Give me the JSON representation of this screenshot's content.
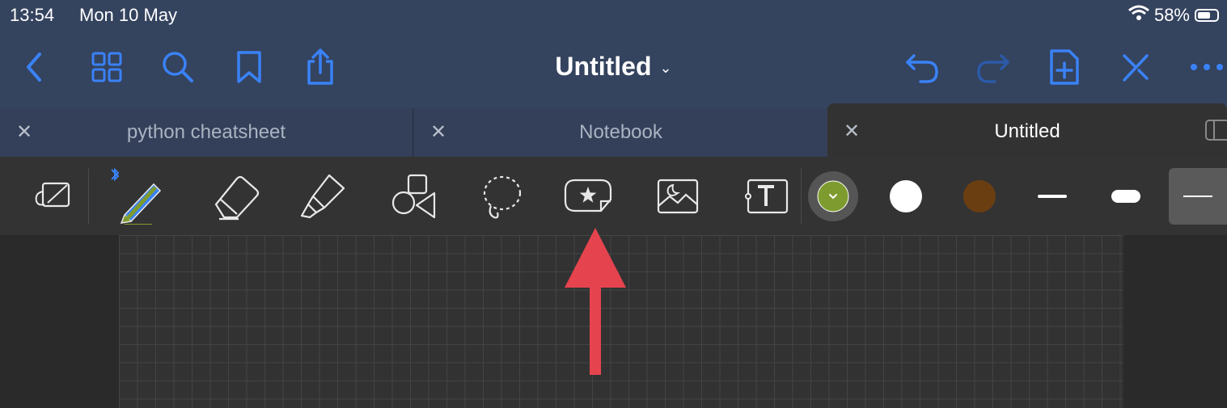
{
  "status_bar": {
    "time": "13:54",
    "date": "Mon 10 May",
    "battery": "58%"
  },
  "nav": {
    "title": "Untitled",
    "accent_color": "#3a82f7"
  },
  "tabs": [
    {
      "label": "python cheatsheet",
      "active": false
    },
    {
      "label": "Notebook",
      "active": false
    },
    {
      "label": "Untitled",
      "active": true
    }
  ],
  "toolbar": {
    "tools": [
      "read-only-mode",
      "pen",
      "eraser",
      "highlighter",
      "shapes",
      "lasso",
      "elements",
      "image",
      "text"
    ],
    "colors": [
      "#7e9b2f",
      "#ffffff",
      "#6b3e12"
    ],
    "selected_color": "#7e9b2f"
  },
  "annotation": {
    "arrow_color": "#e5444f"
  }
}
